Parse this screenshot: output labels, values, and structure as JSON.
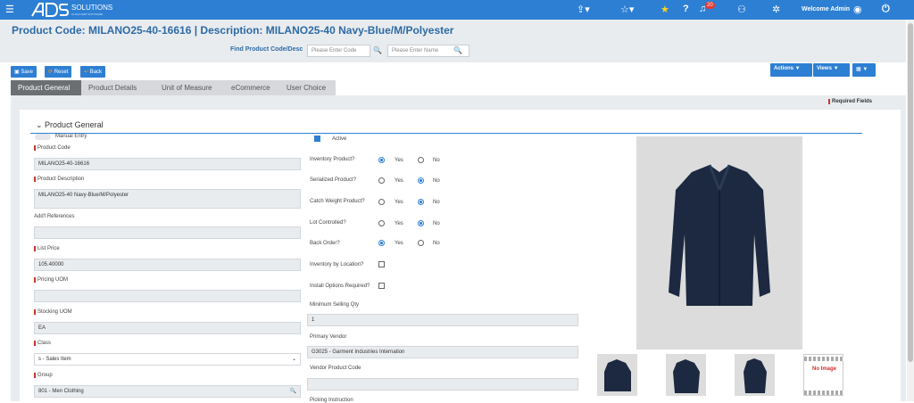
{
  "topbar": {
    "welcome": "Welcome Admin",
    "notifications_count": "20"
  },
  "page": {
    "title": "Product Code:  MILANO25-40-16616 | Description:  MILANO25-40 Navy-Blue/M/Polyester",
    "find_label": "Find Product Code/Desc",
    "code_placeholder": "Please Enter Code",
    "name_placeholder": "Please Enter Name"
  },
  "toolbar": {
    "save": "Save",
    "reset": "Reset",
    "back": "Back",
    "actions": "Actions ▼",
    "views": "Views ▼",
    "list": "▦ ▼"
  },
  "tabs": [
    "Product General",
    "Product Details",
    "Unit of Measure",
    "eCommerce",
    "User Choice"
  ],
  "required_fields": "Required Fields",
  "section": {
    "title": "Product General"
  },
  "left": {
    "manual_entry": "Manual Entry",
    "product_code_label": "Product Code",
    "product_code": "MILANO25-40-16616",
    "description_label": "Product Description",
    "description": "MILANO25-40 Navy-Blue/M/Polyester",
    "refs_label": "Add'l References",
    "refs": "",
    "list_price_label": "List Price",
    "list_price": "105.40000",
    "pricing_uom_label": "Pricing UOM",
    "pricing_uom": "",
    "stocking_uom_label": "Stocking UOM",
    "stocking_uom": "EA",
    "class_label": "Class",
    "class": "s - Sales Item",
    "group_label": "Group",
    "group": "801 - Men Clothing"
  },
  "mid": {
    "active": "Active",
    "inventory": "Inventory Product?",
    "serialized": "Serialized Product?",
    "catch_weight": "Catch Weight Product?",
    "lot": "Lot Controlled?",
    "back_order": "Back Order?",
    "inv_location": "Inventory by Location?",
    "install": "Install Options Required?",
    "yes": "Yes",
    "no": "No",
    "min_qty_label": "Minimum Selling Qty",
    "min_qty": "1",
    "vendor_label": "Primary Vendor",
    "vendor": "G3025 - Garment Industries Internation",
    "vendor_code_label": "Vendor Product Code",
    "vendor_code": "",
    "picking_label": "Picking Instruction"
  },
  "no_image": "No Image"
}
